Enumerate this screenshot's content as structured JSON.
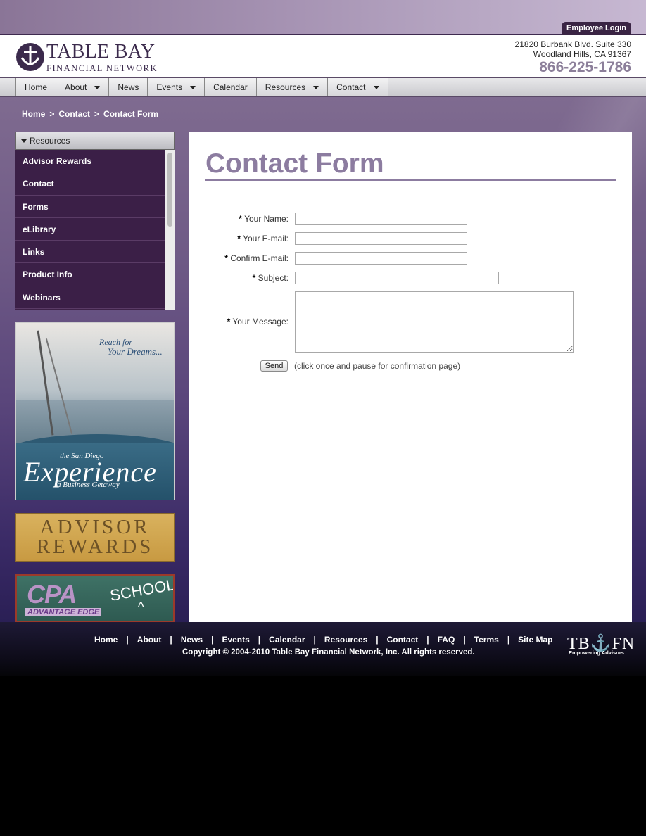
{
  "header": {
    "employee_login": "Employee Login",
    "logo_name": "TABLE BAY",
    "logo_subtitle": "FINANCIAL NETWORK",
    "address_line1": "21820 Burbank Blvd. Suite 330",
    "address_line2": "Woodland Hills, CA 91367",
    "phone": "866-225-1786"
  },
  "nav": {
    "items": [
      {
        "label": "Home",
        "dropdown": false
      },
      {
        "label": "About",
        "dropdown": true
      },
      {
        "label": "News",
        "dropdown": false
      },
      {
        "label": "Events",
        "dropdown": true
      },
      {
        "label": "Calendar",
        "dropdown": false
      },
      {
        "label": "Resources",
        "dropdown": true
      },
      {
        "label": "Contact",
        "dropdown": true
      }
    ]
  },
  "breadcrumb": {
    "items": [
      "Home",
      "Contact",
      "Contact Form"
    ],
    "separator": ">"
  },
  "sidebar": {
    "header": "Resources",
    "items": [
      "Advisor Rewards",
      "Contact",
      "Forms",
      "eLibrary",
      "Links",
      "Product Info",
      "Webinars"
    ]
  },
  "promos": {
    "sandiego": {
      "line1": "Reach for",
      "line2": "Your Dreams...",
      "the": "the San Diego",
      "title": "Experience",
      "subtitle": "a Business Getaway"
    },
    "advisor_rewards": {
      "line1": "ADVISOR",
      "line2": "REWARDS"
    },
    "cpa": {
      "main": "CPA",
      "sub": "ADVANTAGE EDGE",
      "school": "SCHOOL",
      "arrow": "^"
    }
  },
  "content": {
    "title": "Contact Form",
    "fields": [
      {
        "label": "Your Name:",
        "value": ""
      },
      {
        "label": "Your E-mail:",
        "value": ""
      },
      {
        "label": "Confirm E-mail:",
        "value": ""
      },
      {
        "label": "Subject:",
        "value": ""
      },
      {
        "label": "Your Message:",
        "value": ""
      }
    ],
    "required_mark": "*",
    "send_label": "Send",
    "send_note": "(click once and pause for confirmation page)"
  },
  "footer": {
    "links": [
      "Home",
      "About",
      "News",
      "Events",
      "Calendar",
      "Resources",
      "Contact",
      "FAQ",
      "Terms",
      "Site Map"
    ],
    "separator": "|",
    "copyright": "Copyright © 2004-2010 Table Bay Financial Network, Inc. All rights reserved.",
    "logo": "TB⚓FN",
    "tagline": "Empowering Advisors"
  },
  "colors": {
    "brand_purple": "#3b2a4c",
    "title_purple": "#8c7ca0",
    "sidebar_bg": "#3b1f47"
  }
}
